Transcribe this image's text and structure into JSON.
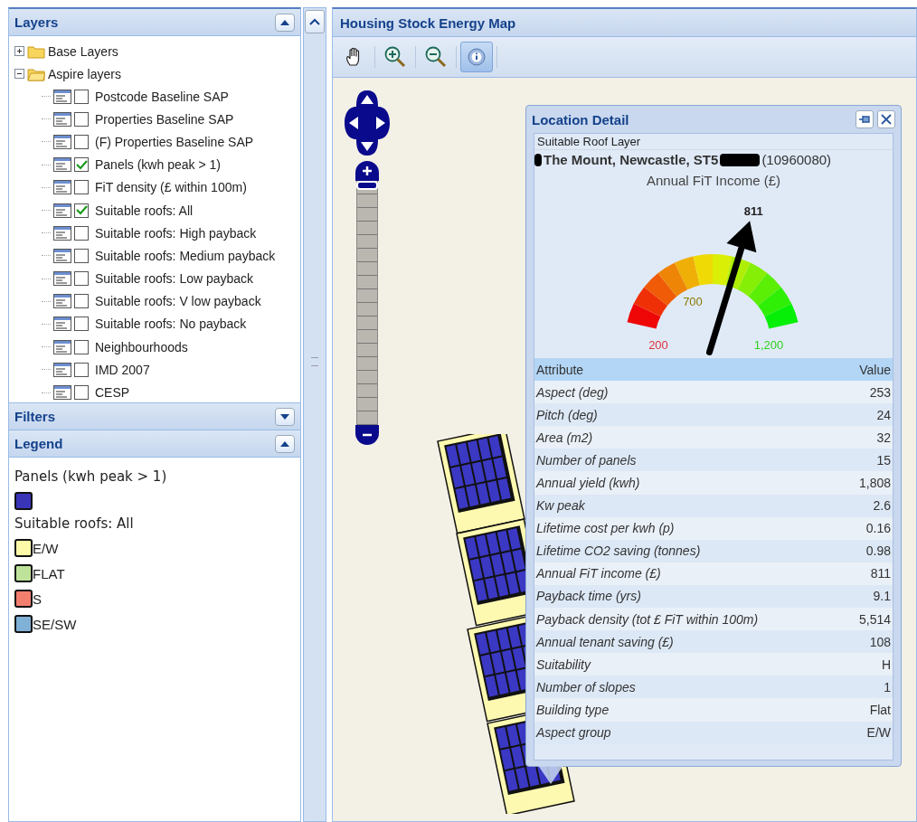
{
  "layers_panel": {
    "title": "Layers",
    "collapsed": false,
    "tree": [
      {
        "label": "Base Layers",
        "expanded": false
      },
      {
        "label": "Aspire layers",
        "expanded": true,
        "children": [
          {
            "label": "Postcode Baseline SAP",
            "checked": false
          },
          {
            "label": "Properties Baseline SAP",
            "checked": false
          },
          {
            "label": "(F) Properties Baseline SAP",
            "checked": false
          },
          {
            "label": "Panels (kwh peak > 1)",
            "checked": true
          },
          {
            "label": "FiT density (£ within 100m)",
            "checked": false
          },
          {
            "label": "Suitable roofs: All",
            "checked": true
          },
          {
            "label": "Suitable roofs: High payback",
            "checked": false
          },
          {
            "label": "Suitable roofs: Medium payback",
            "checked": false
          },
          {
            "label": "Suitable roofs: Low payback",
            "checked": false
          },
          {
            "label": "Suitable roofs: V low payback",
            "checked": false
          },
          {
            "label": "Suitable roofs: No payback",
            "checked": false
          },
          {
            "label": "Neighbourhoods",
            "checked": false
          },
          {
            "label": "IMD 2007",
            "checked": false
          },
          {
            "label": "CESP",
            "checked": false
          }
        ]
      }
    ]
  },
  "filters_panel": {
    "title": "Filters",
    "collapsed": true
  },
  "legend_panel": {
    "title": "Legend",
    "collapsed": false,
    "groups": [
      {
        "title": "Panels (kwh peak > 1)",
        "items": [
          {
            "color": "#3a35b8"
          }
        ]
      },
      {
        "title": "Suitable roofs: All",
        "items": [
          {
            "label": "E/W",
            "color": "#fdf9a8"
          },
          {
            "label": "FLAT",
            "color": "#bfe29a"
          },
          {
            "label": "S",
            "color": "#f27f6e"
          },
          {
            "label": "SE/SW",
            "color": "#7fb0d6"
          }
        ]
      }
    ]
  },
  "map_panel": {
    "title": "Housing Stock Energy Map",
    "tools": [
      {
        "kind": "pan",
        "selected": false
      },
      {
        "kind": "zoom-in",
        "selected": false
      },
      {
        "kind": "zoom-out",
        "selected": false
      },
      {
        "kind": "info",
        "selected": true
      }
    ],
    "zoom": {
      "level": 1
    }
  },
  "popup": {
    "title": "Location Detail",
    "layer": "Suitable Roof Layer",
    "address": "The Mount, Newcastle, ST5",
    "reference": "(10960080)",
    "gauge": {
      "title": "Annual FiT Income (£)",
      "value": "811",
      "ticks": [
        "200",
        "700",
        "1,200"
      ]
    },
    "columns": [
      "Attribute",
      "Value"
    ],
    "rows": [
      [
        "Aspect (deg)",
        "253"
      ],
      [
        "Pitch (deg)",
        "24"
      ],
      [
        "Area (m2)",
        "32"
      ],
      [
        "Number of panels",
        "15"
      ],
      [
        "Annual yield (kwh)",
        "1,808"
      ],
      [
        "Kw peak",
        "2.6"
      ],
      [
        "Lifetime cost per kwh (p)",
        "0.16"
      ],
      [
        "Lifetime CO2 saving (tonnes)",
        "0.98"
      ],
      [
        "Annual FiT income (£)",
        "811"
      ],
      [
        "Payback time (yrs)",
        "9.1"
      ],
      [
        "Payback density (tot £ FiT within 100m)",
        "5,514"
      ],
      [
        "Annual tenant saving (£)",
        "108"
      ],
      [
        "Suitability",
        "H"
      ],
      [
        "Number of slopes",
        "1"
      ],
      [
        "Building type",
        "Flat"
      ],
      [
        "Aspect group",
        "E/W"
      ]
    ]
  }
}
